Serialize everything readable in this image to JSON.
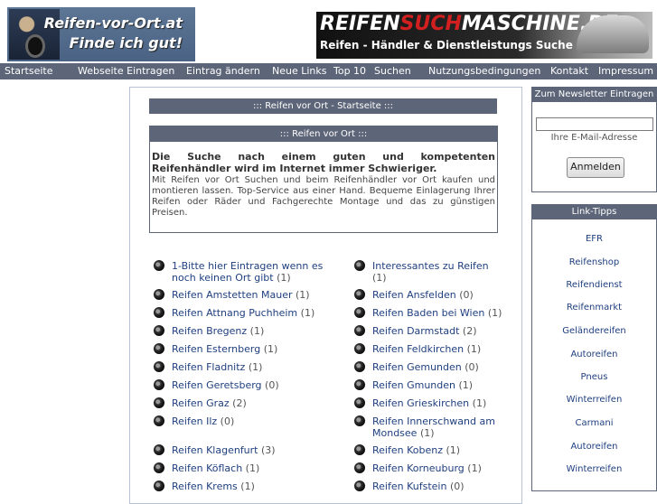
{
  "header": {
    "logo_line1": "Reifen-vor-Ort.at",
    "logo_line2": "Finde ich gut!",
    "banner_part1": "REIFEN",
    "banner_part2": "SUCH",
    "banner_part3": "MASCHINE.DE",
    "banner_sub": "Reifen - Händler & Dienstleistungs Suche"
  },
  "nav": [
    "Startseite",
    "Webseite Eintragen",
    "Eintrag ändern",
    "Neue Links",
    "Top 10",
    "Suchen",
    "Nutzungsbedingungen",
    "Kontakt",
    "Impressum"
  ],
  "main": {
    "title": "::: Reifen vor Ort - Startseite :::",
    "intro_title": "::: Reifen vor Ort :::",
    "intro_bold": "Die Suche nach einem guten und kompetenten Reifenhändler wird im Internet immer Schwieriger.",
    "intro_text": "Mit Reifen vor Ort Suchen und beim Reifenhändler vor Ort kaufen und montieren lassen. Top-Service aus einer Hand. Bequeme Einlagerung Ihrer Reifen oder Räder und Fachgerechte Montage und das zu günstigen Preisen."
  },
  "entries_left": [
    {
      "name": "1-Bitte hier Eintragen wenn es noch keinen Ort gibt",
      "count": "(1)"
    },
    {
      "name": "Reifen Amstetten Mauer",
      "count": "(1)"
    },
    {
      "name": "Reifen Attnang Puchheim",
      "count": "(1)"
    },
    {
      "name": "Reifen Bregenz",
      "count": "(1)"
    },
    {
      "name": "Reifen Esternberg",
      "count": "(1)"
    },
    {
      "name": "Reifen Fladnitz",
      "count": "(1)"
    },
    {
      "name": "Reifen Geretsberg",
      "count": "(0)"
    },
    {
      "name": "Reifen Graz",
      "count": "(2)"
    },
    {
      "name": "Reifen Ilz",
      "count": "(0)"
    },
    {
      "name": "Reifen Klagenfurt",
      "count": "(3)"
    },
    {
      "name": "Reifen Köflach",
      "count": "(1)"
    },
    {
      "name": "Reifen Krems",
      "count": "(1)"
    }
  ],
  "entries_right": [
    {
      "name": "Interessantes zu Reifen",
      "count": "(1)"
    },
    {
      "name": "Reifen Ansfelden",
      "count": "(0)"
    },
    {
      "name": "Reifen Baden bei Wien",
      "count": "(1)"
    },
    {
      "name": "Reifen Darmstadt",
      "count": "(2)"
    },
    {
      "name": "Reifen Feldkirchen",
      "count": "(1)"
    },
    {
      "name": "Reifen Gemunden",
      "count": "(0)"
    },
    {
      "name": "Reifen Gmunden",
      "count": "(1)"
    },
    {
      "name": "Reifen Grieskirchen",
      "count": "(1)"
    },
    {
      "name": "Reifen Innerschwand am Mondsee",
      "count": "(1)"
    },
    {
      "name": "Reifen Kobenz",
      "count": "(1)"
    },
    {
      "name": "Reifen Korneuburg",
      "count": "(1)"
    },
    {
      "name": "Reifen Kufstein",
      "count": "(0)"
    }
  ],
  "newsletter": {
    "title": "Zum Newsletter Eintragen",
    "label": "Ihre E-Mail-Adresse",
    "button": "Anmelden"
  },
  "linktips": {
    "title": "Link-Tipps",
    "items": [
      "EFR",
      "Reifenshop",
      "Reifendienst",
      "Reifenmarkt",
      "Geländereifen",
      "Autoreifen",
      "Pneus",
      "Winterreifen",
      "Carmani",
      "Autoreifen",
      "Winterreifen"
    ]
  }
}
